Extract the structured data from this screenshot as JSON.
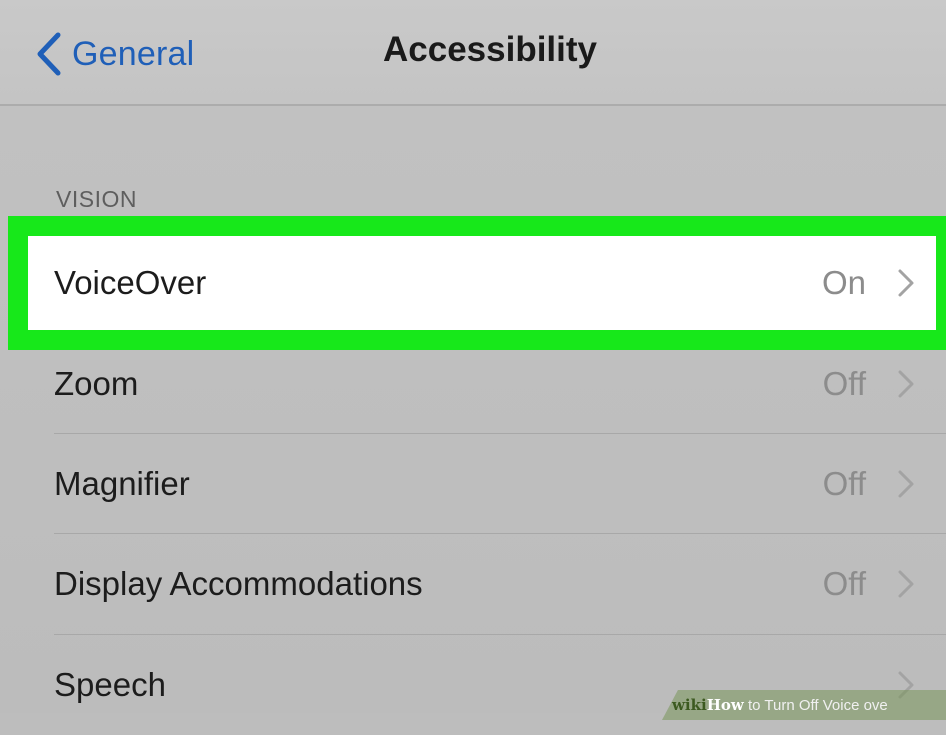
{
  "navbar": {
    "back_label": "General",
    "title": "Accessibility"
  },
  "section": {
    "header": "VISION"
  },
  "rows": [
    {
      "label": "VoiceOver",
      "value": "On"
    },
    {
      "label": "Zoom",
      "value": "Off"
    },
    {
      "label": "Magnifier",
      "value": "Off"
    },
    {
      "label": "Display Accommodations",
      "value": "Off"
    },
    {
      "label": "Speech",
      "value": ""
    }
  ],
  "highlight_color": "#17e81a",
  "accent_color": "#1f5fb8",
  "icons": {
    "back": "chevron-left-icon",
    "disclosure": "chevron-right-icon"
  },
  "watermark": {
    "brand": "wiki",
    "how": "How",
    "text": " to Turn Off Voice ove"
  }
}
